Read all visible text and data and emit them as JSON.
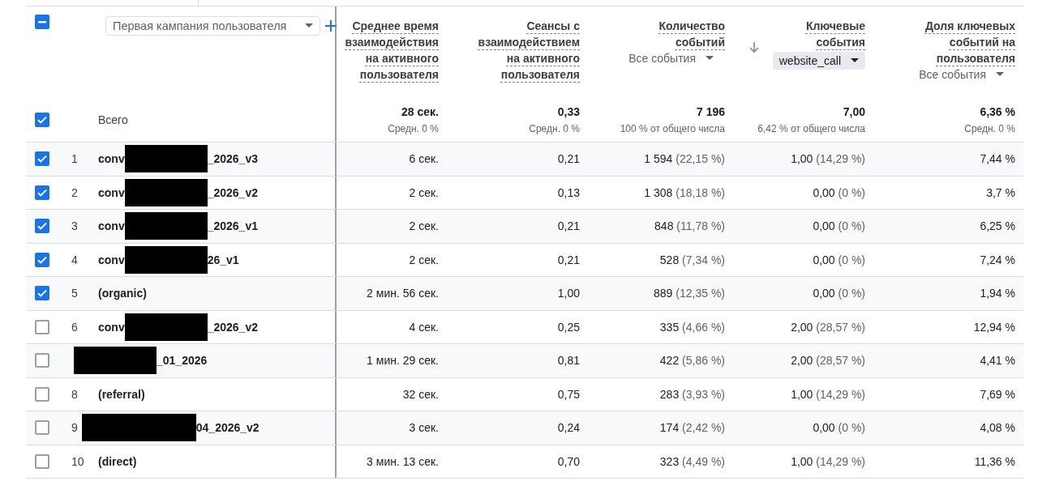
{
  "header": {
    "select_all_indeterminate": true,
    "dimension": "Первая кампания пользователя"
  },
  "columns": [
    {
      "label": "Среднее время взаимодействия на активного пользователя"
    },
    {
      "label": "Сеансы с взаимодействием на активного пользователя"
    },
    {
      "label": "Количество событий",
      "filter": {
        "kind": "text",
        "label": "Все события"
      }
    },
    {
      "label": "Ключевые события",
      "sorted": true,
      "filter": {
        "kind": "chip",
        "label": "website_call"
      }
    },
    {
      "label": "Доля ключевых событий на пользователя",
      "filter": {
        "kind": "text",
        "label": "Все события"
      }
    }
  ],
  "totals": {
    "checked": true,
    "label": "Всего",
    "cells": [
      {
        "value": "28 сек.",
        "note": "Средн. 0 %"
      },
      {
        "value": "0,33",
        "note": "Средн. 0 %"
      },
      {
        "value": "7 196",
        "note": "100 % от общего числа"
      },
      {
        "value": "7,00",
        "note": "6,42 % от общего числа"
      },
      {
        "value": "6,36 %",
        "note": "Средн. 0 %"
      }
    ]
  },
  "rows": [
    {
      "checked": true,
      "index": "1",
      "kind": "masked",
      "name_start": "conv",
      "name_end": "_2026_v3",
      "cells": [
        {
          "value": "6 сек."
        },
        {
          "value": "0,21"
        },
        {
          "value": "1 594",
          "share": "(22,15 %)"
        },
        {
          "value": "1,00",
          "share": "(14,29 %)"
        },
        {
          "value": "7,44 %"
        }
      ]
    },
    {
      "checked": true,
      "index": "2",
      "kind": "masked",
      "name_start": "conv",
      "name_end": "_2026_v2",
      "cells": [
        {
          "value": "2 сек."
        },
        {
          "value": "0,13"
        },
        {
          "value": "1 308",
          "share": "(18,18 %)"
        },
        {
          "value": "0,00",
          "share": "(0 %)"
        },
        {
          "value": "3,7 %"
        }
      ]
    },
    {
      "checked": true,
      "index": "3",
      "kind": "masked",
      "name_start": "conv",
      "name_end": "_2026_v1",
      "cells": [
        {
          "value": "2 сек."
        },
        {
          "value": "0,21"
        },
        {
          "value": "848",
          "share": "(11,78 %)"
        },
        {
          "value": "0,00",
          "share": "(0 %)"
        },
        {
          "value": "6,25 %"
        }
      ]
    },
    {
      "checked": true,
      "index": "4",
      "kind": "masked",
      "name_start": "conv",
      "name_end": "26_v1",
      "cells": [
        {
          "value": "2 сек."
        },
        {
          "value": "0,21"
        },
        {
          "value": "528",
          "share": "(7,34 %)"
        },
        {
          "value": "0,00",
          "share": "(0 %)"
        },
        {
          "value": "7,24 %"
        }
      ]
    },
    {
      "checked": true,
      "index": "5",
      "kind": "plain",
      "name_start": "(organic)",
      "cells": [
        {
          "value": "2 мин. 56 сек."
        },
        {
          "value": "1,00"
        },
        {
          "value": "889",
          "share": "(12,35 %)"
        },
        {
          "value": "0,00",
          "share": "(0 %)"
        },
        {
          "value": "1,94 %"
        }
      ]
    },
    {
      "checked": false,
      "index": "6",
      "kind": "masked",
      "name_start": "conv",
      "name_end": "_2026_v2",
      "cells": [
        {
          "value": "4 сек."
        },
        {
          "value": "0,25"
        },
        {
          "value": "335",
          "share": "(4,66 %)"
        },
        {
          "value": "2,00",
          "share": "(28,57 %)"
        },
        {
          "value": "12,94 %"
        }
      ]
    },
    {
      "checked": false,
      "kind": "masked_index",
      "name_end": "_01_2026",
      "cells": [
        {
          "value": "1 мин. 29 сек."
        },
        {
          "value": "0,81"
        },
        {
          "value": "422",
          "share": "(5,86 %)"
        },
        {
          "value": "2,00",
          "share": "(28,57 %)"
        },
        {
          "value": "4,41 %"
        }
      ]
    },
    {
      "checked": false,
      "index": "8",
      "kind": "plain",
      "name_start": "(referral)",
      "cells": [
        {
          "value": "32 сек."
        },
        {
          "value": "0,75"
        },
        {
          "value": "283",
          "share": "(3,93 %)"
        },
        {
          "value": "1,00",
          "share": "(14,29 %)"
        },
        {
          "value": "7,69 %"
        }
      ]
    },
    {
      "checked": false,
      "index": "9",
      "kind": "masked_start",
      "name_end": "04_2026_v2",
      "cells": [
        {
          "value": "3 сек."
        },
        {
          "value": "0,24"
        },
        {
          "value": "174",
          "share": "(2,42 %)"
        },
        {
          "value": "0,00",
          "share": "(0 %)"
        },
        {
          "value": "4,08 %"
        }
      ]
    },
    {
      "checked": false,
      "index": "10",
      "kind": "plain",
      "name_start": "(direct)",
      "cells": [
        {
          "value": "3 мин. 13 сек."
        },
        {
          "value": "0,70"
        },
        {
          "value": "323",
          "share": "(4,49 %)"
        },
        {
          "value": "1,00",
          "share": "(14,29 %)"
        },
        {
          "value": "11,36 %"
        }
      ]
    }
  ]
}
